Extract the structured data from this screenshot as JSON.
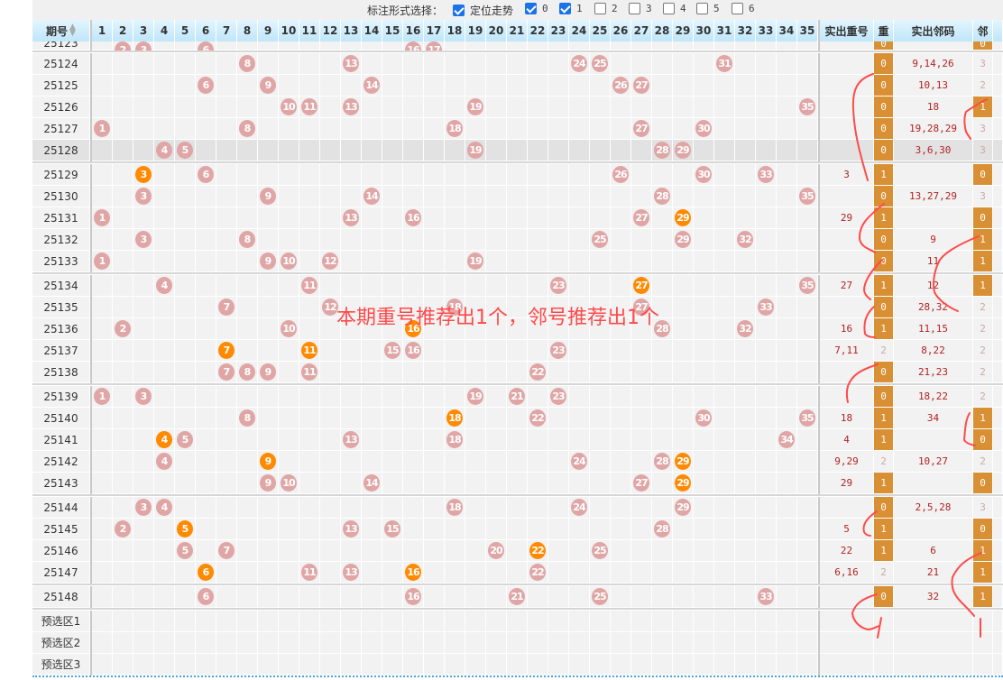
{
  "toolbar": {
    "label": "标注形式选择：",
    "options": [
      {
        "label": "定位走势",
        "checked": true
      },
      {
        "label": "0",
        "checked": true
      },
      {
        "label": "1",
        "checked": true
      },
      {
        "label": "2",
        "checked": false
      },
      {
        "label": "3",
        "checked": false
      },
      {
        "label": "4",
        "checked": false
      },
      {
        "label": "5",
        "checked": false
      },
      {
        "label": "6",
        "checked": false
      }
    ]
  },
  "header": {
    "period": "期号",
    "numbers": [
      "1",
      "2",
      "3",
      "4",
      "5",
      "6",
      "7",
      "8",
      "9",
      "10",
      "11",
      "12",
      "13",
      "14",
      "15",
      "16",
      "17",
      "18",
      "19",
      "20",
      "21",
      "22",
      "23",
      "24",
      "25",
      "26",
      "27",
      "28",
      "29",
      "30",
      "31",
      "32",
      "33",
      "34",
      "35"
    ],
    "repeat": "实出重号",
    "repeat_count": "重",
    "neighbors": "实出邻码",
    "neighbor_count": "邻"
  },
  "partial_row": {
    "period": "25123",
    "balls": [
      2,
      3,
      6,
      16,
      17
    ],
    "rep_count": "0",
    "nb_count": "0"
  },
  "groups": [
    [
      {
        "period": "25124",
        "balls": [
          8,
          13,
          24,
          25,
          31
        ],
        "hot": [],
        "repeat": "",
        "rep_count": "0",
        "neighbors": "9,14,26",
        "nb_count": "3"
      },
      {
        "period": "25125",
        "balls": [
          6,
          9,
          14,
          26,
          27
        ],
        "hot": [],
        "repeat": "",
        "rep_count": "0",
        "neighbors": "10,13",
        "nb_count": "2"
      },
      {
        "period": "25126",
        "balls": [
          10,
          11,
          13,
          19,
          35
        ],
        "hot": [],
        "repeat": "",
        "rep_count": "0",
        "neighbors": "18",
        "nb_count": "1"
      },
      {
        "period": "25127",
        "balls": [
          1,
          8,
          18,
          27,
          30
        ],
        "hot": [],
        "repeat": "",
        "rep_count": "0",
        "neighbors": "19,28,29",
        "nb_count": "3"
      },
      {
        "period": "25128",
        "balls": [
          4,
          5,
          19,
          28,
          29
        ],
        "hot": [],
        "repeat": "",
        "rep_count": "0",
        "neighbors": "3,6,30",
        "nb_count": "3",
        "highlight": true
      }
    ],
    [
      {
        "period": "25129",
        "balls": [
          3,
          6,
          26,
          30,
          33
        ],
        "hot": [
          3
        ],
        "repeat": "3",
        "rep_count": "1",
        "neighbors": "",
        "nb_count": "0"
      },
      {
        "period": "25130",
        "balls": [
          3,
          9,
          14,
          28,
          35
        ],
        "hot": [],
        "repeat": "",
        "rep_count": "0",
        "neighbors": "13,27,29",
        "nb_count": "3"
      },
      {
        "period": "25131",
        "balls": [
          1,
          13,
          16,
          27,
          29
        ],
        "hot": [
          29
        ],
        "repeat": "29",
        "rep_count": "1",
        "neighbors": "",
        "nb_count": "0"
      },
      {
        "period": "25132",
        "balls": [
          3,
          8,
          25,
          29,
          32
        ],
        "hot": [],
        "repeat": "",
        "rep_count": "0",
        "neighbors": "9",
        "nb_count": "1"
      },
      {
        "period": "25133",
        "balls": [
          1,
          9,
          10,
          12,
          19
        ],
        "hot": [],
        "repeat": "",
        "rep_count": "0",
        "neighbors": "11",
        "nb_count": "1"
      }
    ],
    [
      {
        "period": "25134",
        "balls": [
          4,
          11,
          23,
          27,
          35
        ],
        "hot": [
          27
        ],
        "repeat": "27",
        "rep_count": "1",
        "neighbors": "12",
        "nb_count": "1"
      },
      {
        "period": "25135",
        "balls": [
          7,
          12,
          18,
          27,
          33
        ],
        "hot": [],
        "repeat": "",
        "rep_count": "0",
        "neighbors": "28,32",
        "nb_count": "2"
      },
      {
        "period": "25136",
        "balls": [
          2,
          10,
          16,
          28,
          32
        ],
        "hot": [
          16
        ],
        "repeat": "16",
        "rep_count": "1",
        "neighbors": "11,15",
        "nb_count": "2"
      },
      {
        "period": "25137",
        "balls": [
          7,
          11,
          15,
          16,
          23
        ],
        "hot": [
          7,
          11
        ],
        "repeat": "7,11",
        "rep_count": "2",
        "neighbors": "8,22",
        "nb_count": "2"
      },
      {
        "period": "25138",
        "balls": [
          7,
          8,
          9,
          11,
          22
        ],
        "hot": [],
        "repeat": "",
        "rep_count": "0",
        "neighbors": "21,23",
        "nb_count": "2"
      }
    ],
    [
      {
        "period": "25139",
        "balls": [
          1,
          3,
          19,
          21,
          23
        ],
        "hot": [],
        "repeat": "",
        "rep_count": "0",
        "neighbors": "18,22",
        "nb_count": "2"
      },
      {
        "period": "25140",
        "balls": [
          8,
          18,
          22,
          30,
          35
        ],
        "hot": [
          18
        ],
        "repeat": "18",
        "rep_count": "1",
        "neighbors": "34",
        "nb_count": "1"
      },
      {
        "period": "25141",
        "balls": [
          4,
          5,
          13,
          18,
          34
        ],
        "hot": [
          4
        ],
        "repeat": "4",
        "rep_count": "1",
        "neighbors": "",
        "nb_count": "0"
      },
      {
        "period": "25142",
        "balls": [
          4,
          9,
          24,
          28,
          29
        ],
        "hot": [
          9,
          29
        ],
        "repeat": "9,29",
        "rep_count": "2",
        "neighbors": "10,27",
        "nb_count": "2"
      },
      {
        "period": "25143",
        "balls": [
          9,
          10,
          14,
          27,
          29
        ],
        "hot": [
          29
        ],
        "repeat": "29",
        "rep_count": "1",
        "neighbors": "",
        "nb_count": "0"
      }
    ],
    [
      {
        "period": "25144",
        "balls": [
          3,
          4,
          18,
          24,
          29
        ],
        "hot": [],
        "repeat": "",
        "rep_count": "0",
        "neighbors": "2,5,28",
        "nb_count": "3"
      },
      {
        "period": "25145",
        "balls": [
          2,
          5,
          13,
          15,
          28
        ],
        "hot": [
          5
        ],
        "repeat": "5",
        "rep_count": "1",
        "neighbors": "",
        "nb_count": "0"
      },
      {
        "period": "25146",
        "balls": [
          5,
          7,
          20,
          22,
          25
        ],
        "hot": [
          22
        ],
        "repeat": "22",
        "rep_count": "1",
        "neighbors": "6",
        "nb_count": "1"
      },
      {
        "period": "25147",
        "balls": [
          6,
          11,
          13,
          16,
          22
        ],
        "hot": [
          6,
          16
        ],
        "repeat": "6,16",
        "rep_count": "2",
        "neighbors": "21",
        "nb_count": "1"
      }
    ],
    [
      {
        "period": "25148",
        "balls": [
          6,
          16,
          21,
          25,
          33
        ],
        "hot": [],
        "repeat": "",
        "rep_count": "0",
        "neighbors": "32",
        "nb_count": "1"
      }
    ]
  ],
  "preselect": [
    "预选区1",
    "预选区2",
    "预选区3"
  ],
  "overlay_text": "本期重号推荐出1个，邻号推荐出1个",
  "colors": {
    "ball": "#e0a6a6",
    "hot_ball": "#ff8a00",
    "count_highlight": "#d98f33",
    "annotation": "#ff4a4a"
  }
}
